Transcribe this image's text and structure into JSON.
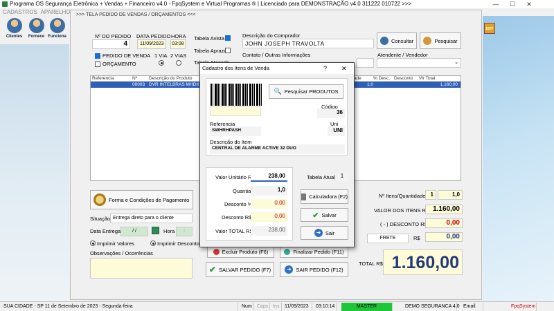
{
  "window": {
    "title": "Programa OS Segurança Eletrônica + Vendas + Financeiro v4.0 - FpqSystem e Virtual Programas ® | Licenciado para  DEMONSTRAÇÃO v4.0 311222 010722 >>>",
    "minimize": "—",
    "maximize": "☐",
    "close": "✕"
  },
  "menu": {
    "items": [
      "CADASTROS",
      "APARELHOS",
      "E"
    ]
  },
  "toolbar": {
    "clientes": "Clientes",
    "fornece": "Fornece",
    "funciona": "Funciona",
    "exit": "EXIT"
  },
  "screen_title": ">>> TELA PEDIDO DE VENDAS / ORÇAMENTOS <<<",
  "order": {
    "num_label": "Nº DO PEDIDO",
    "num": "4",
    "date_label": "DATA PEDIDO",
    "date": "11/09/2023",
    "time_label": "HORA",
    "time": "03:08",
    "type_venda": "PEDIDO DE VENDA",
    "type_orc": "ORÇAMENTO",
    "via1": "1 VIA",
    "via2": "2 VIAS",
    "tabela_vista": "Tabela Avista",
    "tabela_aprazo": "Tabela Aprazo",
    "tabela_atacado": "Tabela Atacado"
  },
  "buyer": {
    "desc_label": "Descrição do Comprador",
    "name": "JOHN JOSEPH TRAVOLTA",
    "contact_label": "Contato / Outras Informações",
    "attendant_label": "Atendente / Vendedor",
    "consultar": "Consultar",
    "pesquisar": "Pesquisar"
  },
  "grid": {
    "headers": [
      "Referencia",
      "Nº",
      "Descrição do Produto",
      "ade",
      "% Desc.",
      "Desconto",
      "Vlr Total"
    ],
    "row": {
      "num": "00003",
      "desc": "DVR INTELBRAS MHDX",
      "qty": "1,0",
      "total": "1.160,00"
    }
  },
  "payment": {
    "button": "Forma e Condições de Pagamento"
  },
  "situation": {
    "label": "Situação",
    "value": "Entrega direto para o cliente",
    "delivery_label": "Data Entrega",
    "delivery_value": "/  /",
    "hour_label": "Hora",
    "hour_value": ":",
    "print_values": "Imprimir Valores",
    "print_discounts": "Imprimir Descontos",
    "obs_label": "Observações / Ocorrências"
  },
  "totals": {
    "items_label": "Nº Itens/Quantidade",
    "items_count": "1",
    "items_qty": "1,0",
    "valor_itens_label": "VALOR DOS ITENS R$",
    "valor_itens": "1.160,00",
    "desconto_label": "( - ) DESCONTO R$",
    "desconto": "0,00",
    "frete_label": "FRETE",
    "frete_currency": "R$",
    "frete": "0,00",
    "total_label": "TOTAL R$",
    "total": "1.160,00"
  },
  "actions": {
    "excluir": "Excluir Produto  (F6)",
    "finalizar": "Finalizar Pedido  (F11)",
    "salvar": "SALVAR PEDIDO (F7)",
    "sair": "SAIR  PEDIDO  (F12)"
  },
  "dialog": {
    "title": "Cadastro dos Itens de Venda",
    "help": "?",
    "close": "✕",
    "search_products": "Pesquisar PRODUTOS",
    "code_label": "Código",
    "code": "36",
    "ref_label": "Referencia",
    "ref": "SWHRHPASH",
    "uni_label": "Uni",
    "uni": "UNI",
    "desc_label": "Descrição do Item",
    "desc": "CENTRAL DE ALARME ACTIVE 32 DUO",
    "unit_price_label": "Valor Unitário R$",
    "unit_price": "238,00",
    "qty_label": "Quantia",
    "qty": "1,0",
    "disc_pct_label": "Desconto %",
    "disc_pct": "0,00",
    "disc_label": "Desconto R$",
    "disc": "0,00",
    "total_label": "Valor TOTAL R$",
    "total": "238,00",
    "table_label": "Tabela Atual",
    "table": "1",
    "calc": "Calculadora (F2)",
    "save": "Salvar",
    "exit": "Sair"
  },
  "status": {
    "city": "SUA CIDADE - SP 11 de Setembro de 2023 - Segunda-feira",
    "num": "Num",
    "caps": "Caps",
    "ins": "Ins",
    "date": "11/09/2023",
    "time": "03:10:14",
    "master": "MASTER",
    "company": "DEMO SEGURANCA 4.0",
    "email": "Email",
    "brand": "FpqSystem"
  },
  "colors": {
    "selection": "#2f60b8",
    "total_blue": "#233a7d",
    "discount_red": "#cc0000",
    "field_yellow": "#fdfbd8",
    "status_green": "#1fc63a"
  }
}
